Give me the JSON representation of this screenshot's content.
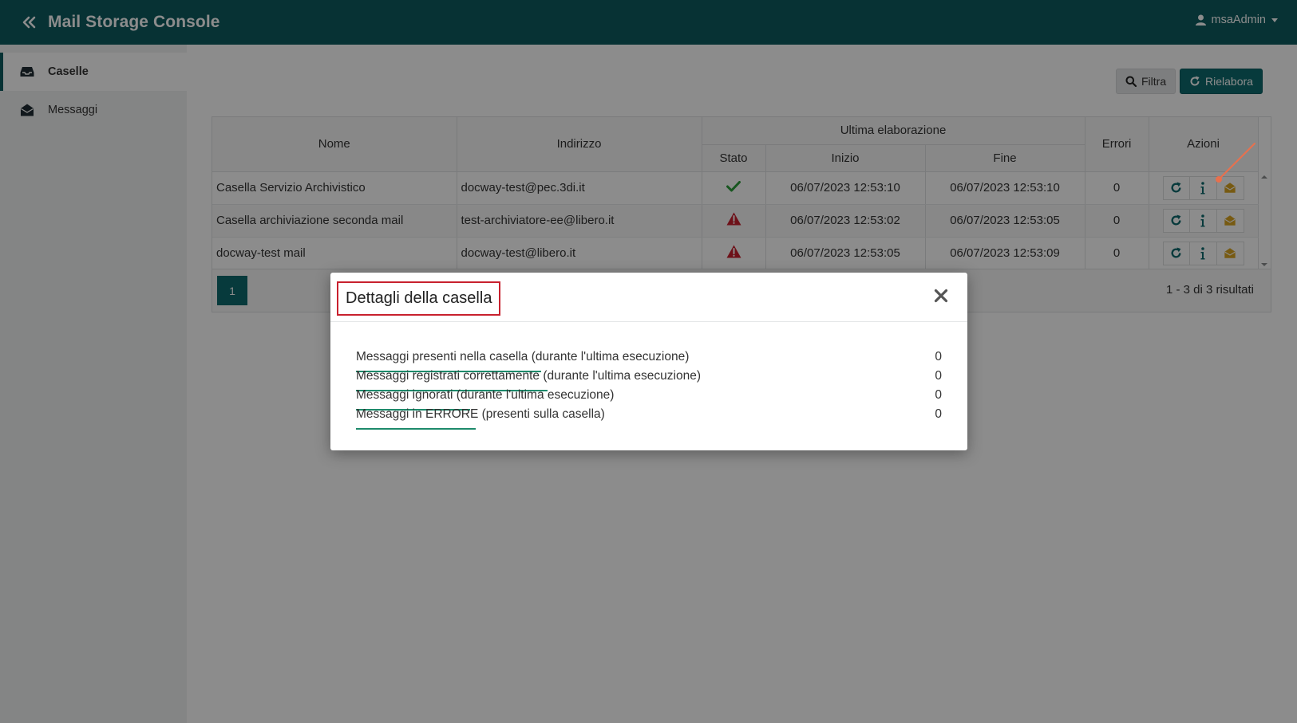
{
  "app": {
    "title": "Mail Storage Console",
    "user": "msaAdmin"
  },
  "sidebar": {
    "items": [
      {
        "label": "Caselle",
        "active": true,
        "icon": "inbox-icon"
      },
      {
        "label": "Messaggi",
        "active": false,
        "icon": "envelope-open-icon"
      }
    ]
  },
  "toolbar": {
    "filter_label": "Filtra",
    "rework_label": "Rielabora"
  },
  "table": {
    "headers": {
      "nome": "Nome",
      "indirizzo": "Indirizzo",
      "group": "Ultima elaborazione",
      "stato": "Stato",
      "inizio": "Inizio",
      "fine": "Fine",
      "errori": "Errori",
      "azioni": "Azioni"
    },
    "rows": [
      {
        "nome": "Casella Servizio Archivistico",
        "indirizzo": "docway-test@pec.3di.it",
        "stato": "ok",
        "inizio": "06/07/2023 12:53:10",
        "fine": "06/07/2023 12:53:10",
        "errori": "0"
      },
      {
        "nome": "Casella archiviazione seconda mail",
        "indirizzo": "test-archiviatore-ee@libero.it",
        "stato": "warning",
        "inizio": "06/07/2023 12:53:02",
        "fine": "06/07/2023 12:53:05",
        "errori": "0"
      },
      {
        "nome": "docway-test mail",
        "indirizzo": "docway-test@libero.it",
        "stato": "warning",
        "inizio": "06/07/2023 12:53:05",
        "fine": "06/07/2023 12:53:09",
        "errori": "0"
      }
    ],
    "pager": {
      "current_page": "1",
      "results": "1 - 3 di 3 risultati"
    }
  },
  "colors": {
    "brand": "#0d5c5f",
    "ok": "#2a9d3a",
    "warning": "#c8202e",
    "mail": "#d9a521",
    "highlight": "#c8202e"
  },
  "modal": {
    "title": "Dettagli della casella",
    "stats": [
      {
        "label": "Messaggi presenti nella casella (durante l'ultima esecuzione)",
        "value": "0"
      },
      {
        "label": "Messaggi registrati correttamente (durante l'ultima esecuzione)",
        "value": "0"
      },
      {
        "label": "Messaggi ignorati (durante l'ultima esecuzione)",
        "value": "0"
      },
      {
        "label": "Messaggi in ERRORE (presenti sulla casella)",
        "value": "0"
      }
    ]
  }
}
